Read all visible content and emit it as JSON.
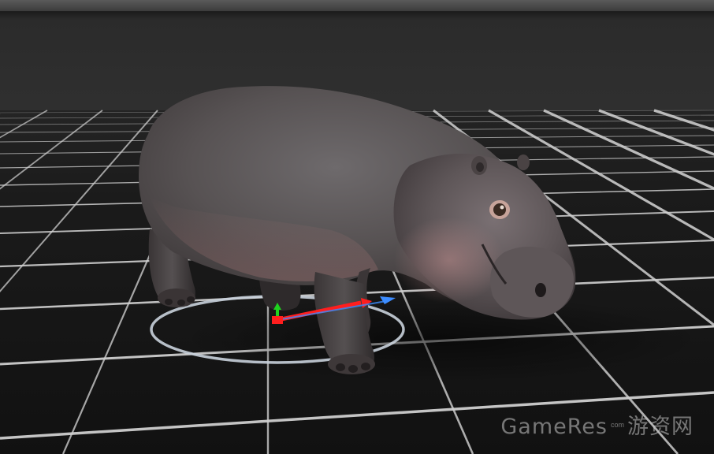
{
  "viewport": {
    "background": "#2f2f2f",
    "grid_color": "#d8d8d8",
    "floor_color": "#151515"
  },
  "subject": {
    "name": "hippo-model"
  },
  "gizmo": {
    "ring_color": "#c9d2dc",
    "x_axis_color": "#ff1e1e",
    "y_axis_color": "#1ed21e",
    "z_axis_color": "#3c8cff"
  },
  "watermark": {
    "brand": "GameRes",
    "suffix": "com",
    "cn": "游资网"
  }
}
